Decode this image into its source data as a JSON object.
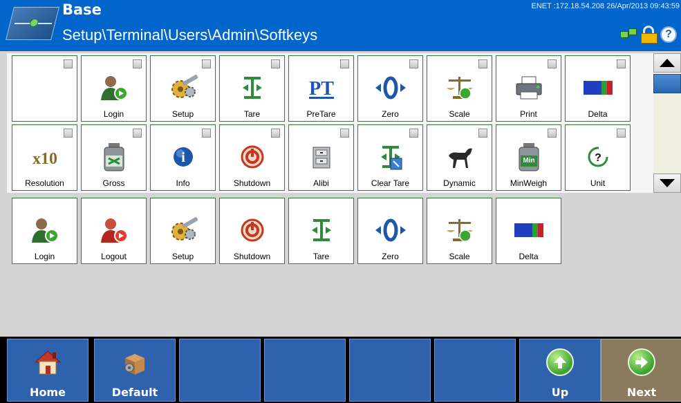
{
  "header": {
    "title": "Base",
    "path": "Setup\\Terminal\\Users\\Admin\\Softkeys",
    "status": "ENET :172.18.54.208  26/Apr/2013 09:43:59"
  },
  "available": [
    {
      "label": "",
      "icon": "blank"
    },
    {
      "label": "Login",
      "icon": "user-login-icon"
    },
    {
      "label": "Setup",
      "icon": "gears-icon"
    },
    {
      "label": "Tare",
      "icon": "tare-icon"
    },
    {
      "label": "PreTare",
      "icon": "pretare-icon"
    },
    {
      "label": "Zero",
      "icon": "zero-icon"
    },
    {
      "label": "Scale",
      "icon": "scale-icon"
    },
    {
      "label": "Print",
      "icon": "printer-icon"
    },
    {
      "label": "Delta",
      "icon": "delta-icon"
    },
    {
      "label": "Resolution",
      "icon": "x10-icon"
    },
    {
      "label": "Gross",
      "icon": "gross-icon"
    },
    {
      "label": "Info",
      "icon": "info-icon"
    },
    {
      "label": "Shutdown",
      "icon": "shutdown-icon"
    },
    {
      "label": "Alibi",
      "icon": "alibi-icon"
    },
    {
      "label": "Clear Tare",
      "icon": "clear-tare-icon"
    },
    {
      "label": "Dynamic",
      "icon": "horse-icon"
    },
    {
      "label": "MinWeigh",
      "icon": "minweigh-icon"
    },
    {
      "label": "Unit",
      "icon": "unit-icon"
    }
  ],
  "selected": [
    {
      "label": "Login",
      "icon": "user-login-icon"
    },
    {
      "label": "Logout",
      "icon": "user-logout-icon"
    },
    {
      "label": "Setup",
      "icon": "gears-icon"
    },
    {
      "label": "Shutdown",
      "icon": "shutdown-icon"
    },
    {
      "label": "Tare",
      "icon": "tare-icon"
    },
    {
      "label": "Zero",
      "icon": "zero-icon"
    },
    {
      "label": "Scale",
      "icon": "scale-icon"
    },
    {
      "label": "Delta",
      "icon": "delta-icon"
    }
  ],
  "softkeys": {
    "home": "Home",
    "default": "Default",
    "up": "Up",
    "next": "Next"
  },
  "icon_text": {
    "pretare": "PT",
    "x10": "x10",
    "minweigh": "Min",
    "unit": "?",
    "info": "i"
  },
  "colors": {
    "header": "#0066cc",
    "softkey": "#2f62ad",
    "next": "#8a7b5f",
    "key_border": "#2e7d32"
  }
}
